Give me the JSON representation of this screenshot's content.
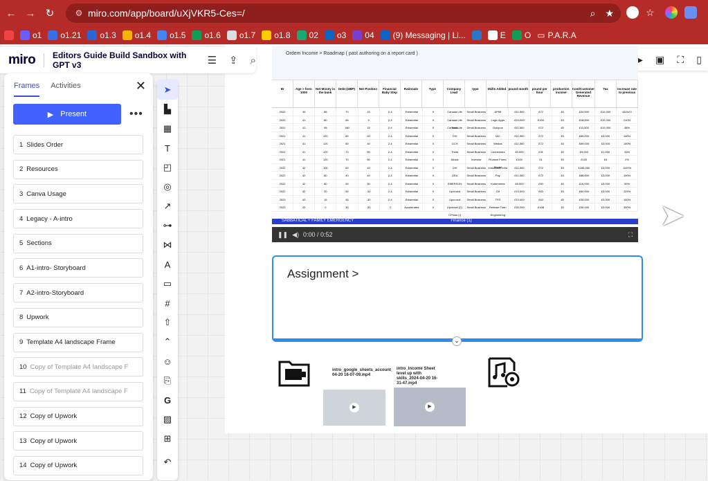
{
  "browser": {
    "url": "miro.com/app/board/uXjVKR5-Ces=/",
    "bookmarks": [
      "o1",
      "o1.21",
      "o1.3",
      "o1.4",
      "o1.5",
      "o1.6",
      "o1.7",
      "o1.8",
      "02",
      "o3",
      "04",
      "(9) Messaging | Li...",
      "E",
      "O",
      "P.A.R.A"
    ]
  },
  "topbar": {
    "logo": "miro",
    "board_title": "Editors Guide Build Sandbox with GPT v3"
  },
  "panel": {
    "tabs": [
      "Frames",
      "Activities"
    ],
    "present_label": "Present",
    "frames": [
      {
        "num": "1",
        "label": "Slides Order"
      },
      {
        "num": "2",
        "label": "Resources"
      },
      {
        "num": "3",
        "label": "Canva Usage"
      },
      {
        "num": "4",
        "label": "Legacy - A-intro"
      },
      {
        "num": "5",
        "label": "Sections"
      },
      {
        "num": "6",
        "label": "A1-intro- Storyboard"
      },
      {
        "num": "7",
        "label": "A2-intro-Storyboard"
      },
      {
        "num": "8",
        "label": "Upwork"
      },
      {
        "num": "9",
        "label": "Template A4 landscape Frame"
      },
      {
        "num": "10",
        "label": "Copy of Template A4 landscape F"
      },
      {
        "num": "11",
        "label": "Copy of Template A4 landscape F"
      },
      {
        "num": "12",
        "label": "Copy of Upwork"
      },
      {
        "num": "13",
        "label": "Copy of Upwork"
      },
      {
        "num": "14",
        "label": "Copy of Upwork"
      }
    ]
  },
  "video": {
    "sheet_title": "Ordem Income > Roadmap ( past authoring on a report card )",
    "columns": [
      "ID",
      "Age > form 1000",
      "Net Money in the bank",
      "Debt (GBP)",
      "Net Position",
      "Financial Baby Step",
      "Rationale",
      "Type",
      "Company Lead",
      "type",
      "Skills Added",
      "pound month",
      "pound per hour",
      "production income",
      "Cost/Customer Generated Revenue",
      "Tax",
      "Increase rate to previous"
    ],
    "rows": [
      [
        "2020",
        "40",
        "85",
        "70",
        "15",
        "2-4",
        "Existential",
        "0",
        "Canada Life",
        "Small Business",
        "APIM",
        "£11,500",
        "£72",
        "£0",
        "£34,500",
        "£10,000",
        "#DIV/0!"
      ],
      [
        "2021",
        "41",
        "80",
        "65",
        "5",
        "2-4",
        "Existential",
        "0",
        "Canada Life Theta",
        "Small Business",
        "Logic Apps",
        "£24,000",
        "£150",
        "£0",
        "£18,000",
        "£10,000",
        "210%"
      ],
      [
        "2021",
        "41",
        "95",
        "180",
        "15",
        "2-4",
        "Existential",
        "0",
        "Canada Life",
        "Small Business",
        "Octopus",
        "£11,500",
        "£72",
        "£0",
        "£11,500",
        "£10,000",
        "48%"
      ],
      [
        "2021",
        "41",
        "120",
        "80",
        "40",
        "2-4",
        "Existential",
        "0",
        "CHI",
        "Small Business",
        "IAC",
        "£11,500",
        "£72",
        "£0",
        "£69,000",
        "£3,000",
        "100%"
      ],
      [
        "2021",
        "41",
        "120",
        "80",
        "40",
        "2-4",
        "Existential",
        "0",
        "GCH",
        "Small Business",
        "Wedza",
        "£11,500",
        "£72",
        "£0",
        "£69,000",
        "£3,000",
        "100%"
      ],
      [
        "2021",
        "41",
        "120",
        "70",
        "50",
        "2-4",
        "Existential",
        "0",
        "Theta",
        "Small Business",
        "Connectors",
        "£5,000",
        "£31",
        "£0",
        "£9,000",
        "£1,000",
        "43%"
      ],
      [
        "2021",
        "41",
        "120",
        "70",
        "50",
        "2-4",
        "Existential",
        "0",
        "Iklusic",
        "Investor",
        "Finance Forec. Model",
        "£100",
        "£1",
        "£0",
        "£100",
        "£0",
        "2%"
      ],
      [
        "2022",
        "42",
        "100",
        "60",
        "40",
        "2-4",
        "Existential",
        "0",
        "CHI",
        "Small Business",
        "Immutable Infra",
        "£11,500",
        "£72",
        "£0",
        "£165,000",
        "£3,000",
        "1100%"
      ],
      [
        "2022",
        "42",
        "80",
        "40",
        "40",
        "2-4",
        "Existential",
        "0",
        "GEA",
        "Small Business",
        "Pay",
        "£11,500",
        "£72",
        "£0",
        "£88,000",
        "£3,000",
        "100%"
      ],
      [
        "2022",
        "42",
        "80",
        "50",
        "30",
        "2-4",
        "Existential",
        "0",
        "EMERSON",
        "Small Business",
        "Kubernetes",
        "£8,000",
        "£50",
        "£0",
        "£16,000",
        "£3,000",
        "50%"
      ],
      [
        "2022",
        "42",
        "20",
        "50",
        "-30",
        "2-4",
        "Existential",
        "0",
        "Upcrowd",
        "Small Business",
        "Git",
        "£10,000",
        "£63",
        "£0",
        "£60,000",
        "£3,000",
        "125%"
      ],
      [
        "2023",
        "43",
        "15",
        "45",
        "-30",
        "2-4",
        "Existential",
        "0",
        "Upcrowd",
        "Small Business",
        "TFS",
        "£10,000",
        "£63",
        "£0",
        "£30,000",
        "£3,000",
        "100%"
      ],
      [
        "2023",
        "43",
        "0",
        "30",
        "-30",
        "2",
        "Accelerated",
        "0",
        "Upcrowd (C) CPmax (I)",
        "Small Business",
        "Release Train Engineering",
        "£30,000",
        "£188",
        "£0",
        "£30,000",
        "£3,000",
        "300%"
      ]
    ],
    "banner": "SABBATICAL + FAMILY EMERGENCY",
    "banner_right": "Finance (1)",
    "timestamp": "0:00 / 0:52"
  },
  "assignment": {
    "title": "Assignment >"
  },
  "files": [
    {
      "caption": "intro_google_sheets_account_2024-04-20 16-07-09.mp4"
    },
    {
      "caption": "intro_Income Sheet level up with skills_2024-04-20 16-31-47.mp4"
    }
  ],
  "colors": {
    "chrome": "#b52b27",
    "accent": "#4262ff",
    "frame_border": "#2d8ced"
  }
}
